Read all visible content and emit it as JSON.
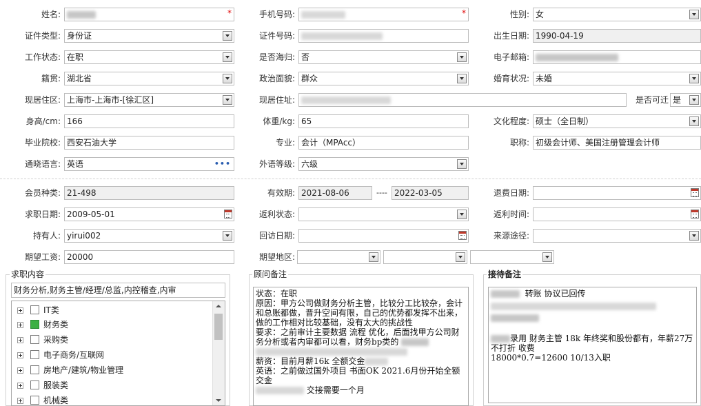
{
  "profile": {
    "name": {
      "label": "姓名:"
    },
    "mobile": {
      "label": "手机号码:"
    },
    "gender": {
      "label": "性别:",
      "value": "女"
    },
    "id_type": {
      "label": "证件类型:",
      "value": "身份证"
    },
    "id_number": {
      "label": "证件号码:"
    },
    "birth_date": {
      "label": "出生日期:",
      "value": "1990-04-19"
    },
    "work_status": {
      "label": "工作状态:",
      "value": "在职"
    },
    "overseas": {
      "label": "是否海归:",
      "value": "否"
    },
    "email": {
      "label": "电子邮箱:"
    },
    "native_place": {
      "label": "籍贯:",
      "value": "湖北省"
    },
    "political": {
      "label": "政治面貌:",
      "value": "群众"
    },
    "marital": {
      "label": "婚育状况:",
      "value": "未婚"
    },
    "residence_area": {
      "label": "现居住区:",
      "value": "上海市-上海市-[徐汇区]"
    },
    "residence_address": {
      "label": "现居住址:"
    },
    "relocate": {
      "label": "是否可迁",
      "value": "是"
    },
    "height": {
      "label": "身高/cm:",
      "value": "166"
    },
    "weight": {
      "label": "体重/kg:",
      "value": "65"
    },
    "education": {
      "label": "文化程度:",
      "value": "硕士（全日制）"
    },
    "school": {
      "label": "毕业院校:",
      "value": "西安石油大学"
    },
    "major": {
      "label": "专业:",
      "value": "会计（MPAcc）"
    },
    "title": {
      "label": "职称:",
      "value": "初级会计师、美国注册管理会计师"
    },
    "language": {
      "label": "通晓语言:",
      "value": "英语"
    },
    "language_level": {
      "label": "外语等级:",
      "value": "六级"
    }
  },
  "membership": {
    "member_type": {
      "label": "会员种类:",
      "value": "21-498"
    },
    "validity": {
      "label": "有效期:",
      "start": "2021-08-06",
      "sep": "----",
      "end": "2022-03-05"
    },
    "refund_date": {
      "label": "退费日期:",
      "value": ""
    },
    "job_date": {
      "label": "求职日期:",
      "value": "2009-05-01"
    },
    "rebate_status": {
      "label": "返利状态:",
      "value": ""
    },
    "rebate_time": {
      "label": "返利时间:",
      "value": ""
    },
    "holder": {
      "label": "持有人:",
      "value": "yirui002"
    },
    "callback_date": {
      "label": "回访日期:",
      "value": ""
    },
    "source": {
      "label": "来源途径:",
      "value": ""
    },
    "expected_salary": {
      "label": "期望工资:",
      "value": "20000"
    },
    "expected_area": {
      "label": "期望地区:"
    }
  },
  "job_content": {
    "title": "求职内容",
    "summary": "财务分析,财务主管/经理/总监,内控稽查,内审",
    "categories": [
      {
        "label": "IT类",
        "checked": false
      },
      {
        "label": "财务类",
        "checked": true
      },
      {
        "label": "采购类",
        "checked": false
      },
      {
        "label": "电子商务/互联网",
        "checked": false
      },
      {
        "label": "房地产/建筑/物业管理",
        "checked": false
      },
      {
        "label": "服装类",
        "checked": false
      },
      {
        "label": "机械类",
        "checked": false
      }
    ]
  },
  "consultant_notes": {
    "title": "顾问备注",
    "lines": [
      "状态：在职",
      "原因：甲方公司做财务分析主管，比较分工比较杂，会计和总账都做，晋升空间有限，自己的优势都发挥不出来，做的工作相对比较基础，没有太大的挑战性",
      "要求：之前审计主要数据 流程 优化，后面找甲方公司财务分析或者内审都可以看，财务bp类的",
      "薪资：目前月薪16k 全额交金",
      "英语：之前做过国外项目  书面OK  2021.6月份开始全额交金",
      "交接需要一个月"
    ]
  },
  "reception_notes": {
    "title": "接待备注",
    "line1": "转账 协议已回传",
    "line2a": "录用  财务主管 18k 年终奖和股份都有，年薪27万不打折 收费",
    "line3": "18000*0.7=12600  10/13入职"
  }
}
